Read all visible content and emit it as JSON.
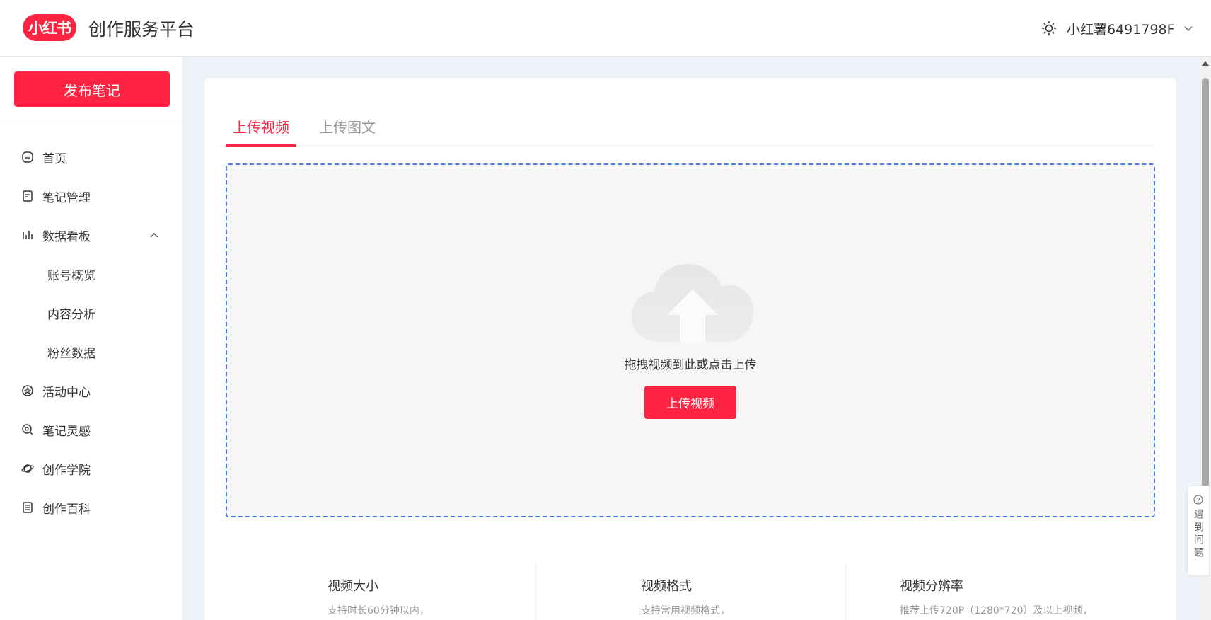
{
  "header": {
    "logo_text": "小红书",
    "platform_title": "创作服务平台",
    "username": "小红薯6491798F"
  },
  "sidebar": {
    "publish_label": "发布笔记",
    "items": [
      {
        "label": "首页",
        "icon": "home-icon"
      },
      {
        "label": "笔记管理",
        "icon": "note-icon"
      },
      {
        "label": "数据看板",
        "icon": "chart-icon"
      },
      {
        "label": "账号概览"
      },
      {
        "label": "内容分析"
      },
      {
        "label": "粉丝数据"
      },
      {
        "label": "活动中心",
        "icon": "activity-icon"
      },
      {
        "label": "笔记灵感",
        "icon": "inspiration-icon"
      },
      {
        "label": "创作学院",
        "icon": "planet-icon"
      },
      {
        "label": "创作百科",
        "icon": "book-icon"
      }
    ]
  },
  "main": {
    "tabs": [
      {
        "label": "上传视频",
        "active": true
      },
      {
        "label": "上传图文",
        "active": false
      }
    ],
    "dropzone": {
      "hint": "拖拽视频到此或点击上传",
      "button_label": "上传视频"
    },
    "specs": [
      {
        "title": "视频大小",
        "desc": "支持时长60分钟以内，"
      },
      {
        "title": "视频格式",
        "desc": "支持常用视频格式，"
      },
      {
        "title": "视频分辨率",
        "desc": "推荐上传720P（1280*720）及以上视频，"
      }
    ]
  },
  "help": {
    "label": "遇到问题"
  },
  "colors": {
    "accent": "#ff2442",
    "dashed_border": "#4a7bf5"
  }
}
